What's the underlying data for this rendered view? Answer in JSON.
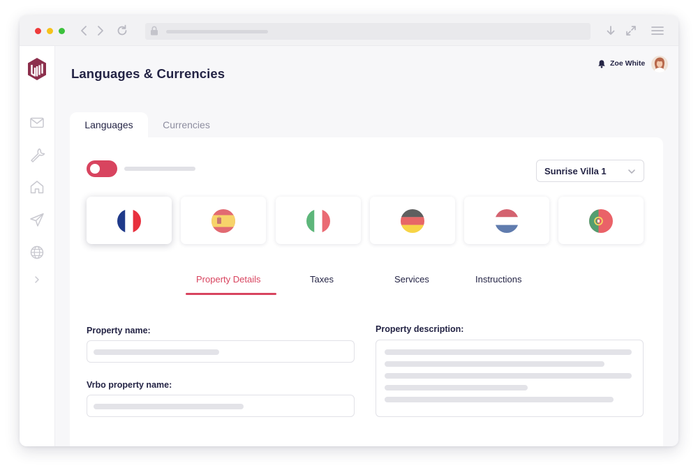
{
  "window": {
    "controls": [
      "close",
      "minimize",
      "maximize"
    ]
  },
  "browser": {
    "nav_icons": [
      "back-icon",
      "forward-icon",
      "reload-icon"
    ],
    "address_icon": "lock-icon",
    "right_icons": [
      "download-icon",
      "expand-icon",
      "menu-icon"
    ]
  },
  "sidebar": {
    "logo": "app-logo",
    "items": [
      {
        "icon": "mail-icon"
      },
      {
        "icon": "wrench-icon"
      },
      {
        "icon": "home-icon"
      },
      {
        "icon": "send-icon"
      },
      {
        "icon": "globe-icon"
      },
      {
        "icon": "chevron-right-icon"
      }
    ]
  },
  "header": {
    "title": "Languages & Currencies",
    "user": {
      "name": "Zoe White",
      "icon": "bell-icon"
    }
  },
  "tabs": [
    {
      "label": "Languages",
      "active": true
    },
    {
      "label": "Currencies",
      "active": false
    }
  ],
  "toolbar": {
    "toggle_on": true,
    "property_select": {
      "value": "Sunrise Villa 1"
    }
  },
  "languages": [
    {
      "flag": "france-flag",
      "selected": true
    },
    {
      "flag": "spain-flag",
      "selected": false
    },
    {
      "flag": "italy-flag",
      "selected": false
    },
    {
      "flag": "germany-flag",
      "selected": false
    },
    {
      "flag": "netherlands-flag",
      "selected": false
    },
    {
      "flag": "portugal-flag",
      "selected": false
    }
  ],
  "subtabs": [
    {
      "label": "Property Details",
      "active": true
    },
    {
      "label": "Taxes",
      "active": false
    },
    {
      "label": "Services",
      "active": false
    },
    {
      "label": "Instructions",
      "active": false
    }
  ],
  "form": {
    "property_name_label": "Property name:",
    "vrbo_name_label": "Vrbo property name:",
    "description_label": "Property description:"
  },
  "colors": {
    "accent": "#d8445f",
    "title": "#242445",
    "muted": "#8e8ea0",
    "background": "#f7f7f9"
  }
}
